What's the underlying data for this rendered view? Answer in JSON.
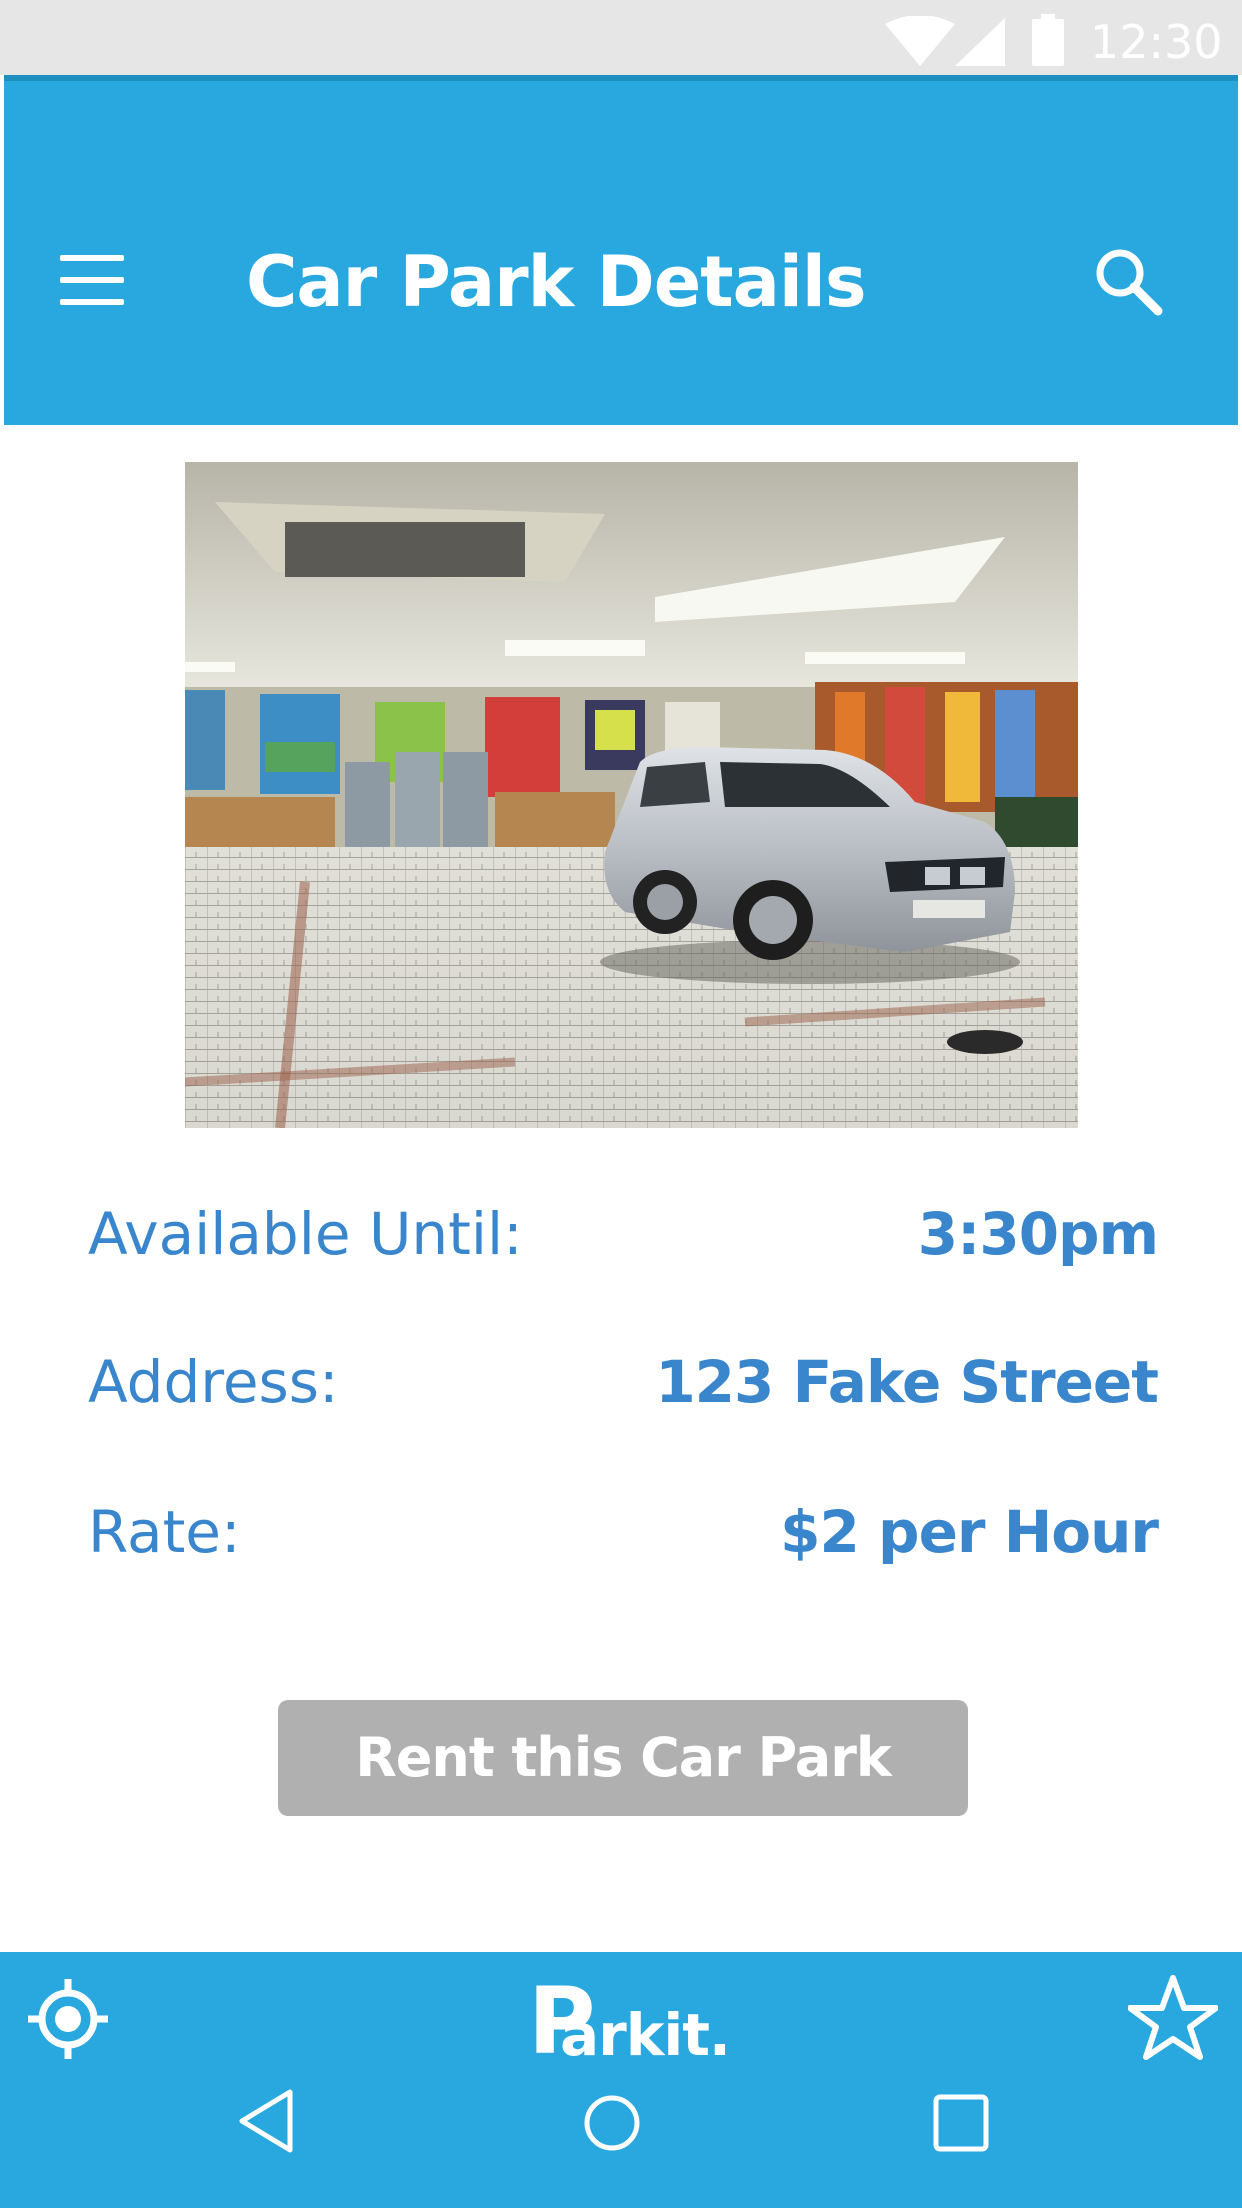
{
  "status_bar": {
    "time": "12:30",
    "icons": [
      "wifi-icon",
      "cell-signal-icon",
      "battery-icon"
    ]
  },
  "app_bar": {
    "title": "Car Park Details",
    "menu_icon": "hamburger-menu-icon",
    "search_icon": "search-icon"
  },
  "photo": {
    "subject": "silver car parked indoors"
  },
  "details": {
    "available_until": {
      "label": "Available Until:",
      "value": "3:30pm"
    },
    "address": {
      "label": "Address:",
      "value": "123 Fake Street"
    },
    "rate": {
      "label": "Rate:",
      "value": "$2 per Hour"
    }
  },
  "actions": {
    "rent_label": "Rent this Car Park"
  },
  "bottom_bar": {
    "logo_initial": "P",
    "logo_rest": "arkit.",
    "locate_icon": "crosshair-locate-icon",
    "favorite_icon": "star-icon"
  },
  "nav": {
    "back_icon": "back-triangle-icon",
    "home_icon": "home-circle-icon",
    "recent_icon": "recent-apps-square-icon"
  },
  "colors": {
    "primary": "#29a8e0",
    "text_accent": "#3a86cd",
    "button_disabled": "#b0b0b0",
    "status_bar": "#e6e6e6"
  }
}
